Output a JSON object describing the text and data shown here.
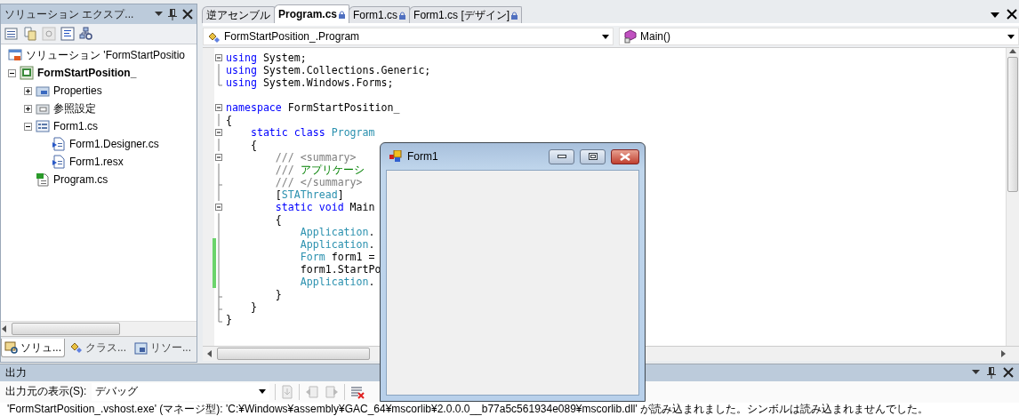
{
  "solution_explorer": {
    "title": "ソリューション エクスプ...",
    "tree": [
      {
        "label": "ソリューション 'FormStartPositio",
        "kind": "solution",
        "children": [
          {
            "label": "FormStartPosition_",
            "kind": "project",
            "expanded": true,
            "children": [
              {
                "label": "Properties",
                "kind": "properties",
                "expanded": false
              },
              {
                "label": "参照設定",
                "kind": "references",
                "expanded": false
              },
              {
                "label": "Form1.cs",
                "kind": "form",
                "expanded": true,
                "children": [
                  {
                    "label": "Form1.Designer.cs",
                    "kind": "file"
                  },
                  {
                    "label": "Form1.resx",
                    "kind": "file"
                  }
                ]
              },
              {
                "label": "Program.cs",
                "kind": "csharp"
              }
            ]
          }
        ]
      }
    ],
    "bottom_tabs": [
      {
        "label": "ソリュ...",
        "selected": true
      },
      {
        "label": "クラス...",
        "selected": false
      },
      {
        "label": "リソー...",
        "selected": false
      }
    ]
  },
  "editor": {
    "tabs": [
      {
        "label": "逆アセンブル",
        "selected": false,
        "locked": false
      },
      {
        "label": "Program.cs",
        "selected": true,
        "locked": true
      },
      {
        "label": "Form1.cs",
        "selected": false,
        "locked": true
      },
      {
        "label": "Form1.cs [デザイン]",
        "selected": false,
        "locked": true
      }
    ],
    "type_dropdown": "FormStartPosition_.Program",
    "member_dropdown": "Main()",
    "lines": [
      {
        "kind": "start",
        "changed": false,
        "tokens": [
          {
            "kind": "keyword",
            "text": "using"
          },
          {
            "kind": "plain",
            "text": " System;"
          }
        ]
      },
      {
        "kind": "inner",
        "changed": false,
        "tokens": [
          {
            "kind": "keyword",
            "text": "using"
          },
          {
            "kind": "plain",
            "text": " System.Collections.Generic;"
          }
        ]
      },
      {
        "kind": "end",
        "changed": false,
        "tokens": [
          {
            "kind": "keyword",
            "text": "using"
          },
          {
            "kind": "plain",
            "text": " System.Windows.Forms;"
          }
        ]
      },
      {
        "kind": "blank"
      },
      {
        "kind": "start",
        "changed": false,
        "tokens": [
          {
            "kind": "keyword",
            "text": "namespace"
          },
          {
            "kind": "plain",
            "text": " FormStartPosition_"
          }
        ]
      },
      {
        "kind": "inner",
        "changed": false,
        "tokens": [
          {
            "kind": "plain",
            "text": "{"
          }
        ]
      },
      {
        "kind": "start",
        "changed": false,
        "tokens": [
          {
            "kind": "keyword",
            "text": "    static class"
          },
          {
            "kind": "type",
            "text": " Program"
          }
        ]
      },
      {
        "kind": "inner",
        "changed": false,
        "tokens": [
          {
            "kind": "plain",
            "text": "    {"
          }
        ]
      },
      {
        "kind": "start",
        "changed": false,
        "tokens": [
          {
            "kind": "comment",
            "text": "        /// <summary>"
          }
        ]
      },
      {
        "kind": "inner",
        "changed": false,
        "tokens": [
          {
            "kind": "comment",
            "text": "        ///"
          },
          {
            "kind": "comment-text",
            "text": " アプリケーシ"
          }
        ]
      },
      {
        "kind": "tick",
        "changed": false,
        "tokens": [
          {
            "kind": "comment",
            "text": "        /// </summary>"
          }
        ]
      },
      {
        "kind": "inner",
        "changed": false,
        "tokens": [
          {
            "kind": "plain",
            "text": "        ["
          },
          {
            "kind": "type",
            "text": "STAThread"
          },
          {
            "kind": "plain",
            "text": "]"
          }
        ]
      },
      {
        "kind": "start",
        "changed": false,
        "tokens": [
          {
            "kind": "keyword",
            "text": "        static void"
          },
          {
            "kind": "plain",
            "text": " Main"
          }
        ]
      },
      {
        "kind": "inner",
        "changed": false,
        "tokens": [
          {
            "kind": "plain",
            "text": "        {"
          }
        ]
      },
      {
        "kind": "inner",
        "changed": false,
        "tokens": [
          {
            "kind": "type",
            "text": "            Application"
          },
          {
            "kind": "plain",
            "text": "."
          }
        ]
      },
      {
        "kind": "inner",
        "changed": true,
        "tokens": [
          {
            "kind": "type",
            "text": "            Application"
          },
          {
            "kind": "plain",
            "text": "."
          }
        ]
      },
      {
        "kind": "inner",
        "changed": true,
        "tokens": [
          {
            "kind": "type",
            "text": "            Form"
          },
          {
            "kind": "plain",
            "text": " form1 ="
          }
        ]
      },
      {
        "kind": "inner",
        "changed": true,
        "tokens": [
          {
            "kind": "plain",
            "text": "            form1.StartPo"
          }
        ]
      },
      {
        "kind": "inner",
        "changed": true,
        "tokens": [
          {
            "kind": "type",
            "text": "            Application"
          },
          {
            "kind": "plain",
            "text": "."
          }
        ]
      },
      {
        "kind": "tick",
        "changed": false,
        "tokens": [
          {
            "kind": "plain",
            "text": "        }"
          }
        ]
      },
      {
        "kind": "tick",
        "changed": false,
        "tokens": [
          {
            "kind": "plain",
            "text": "    }"
          }
        ]
      },
      {
        "kind": "end",
        "changed": false,
        "tokens": [
          {
            "kind": "plain",
            "text": "}"
          }
        ]
      }
    ]
  },
  "output": {
    "title": "出力",
    "source_label": "出力元の表示(S):",
    "source": "デバッグ",
    "text": "'FormStartPosition_.vshost.exe' (マネージ型): 'C:¥Windows¥assembly¥GAC_64¥mscorlib¥2.0.0.0__b77a5c561934e089¥mscorlib.dll' が読み込まれました。シンボルは読み込まれませんでした。"
  },
  "form_window": {
    "title": "Form1"
  }
}
